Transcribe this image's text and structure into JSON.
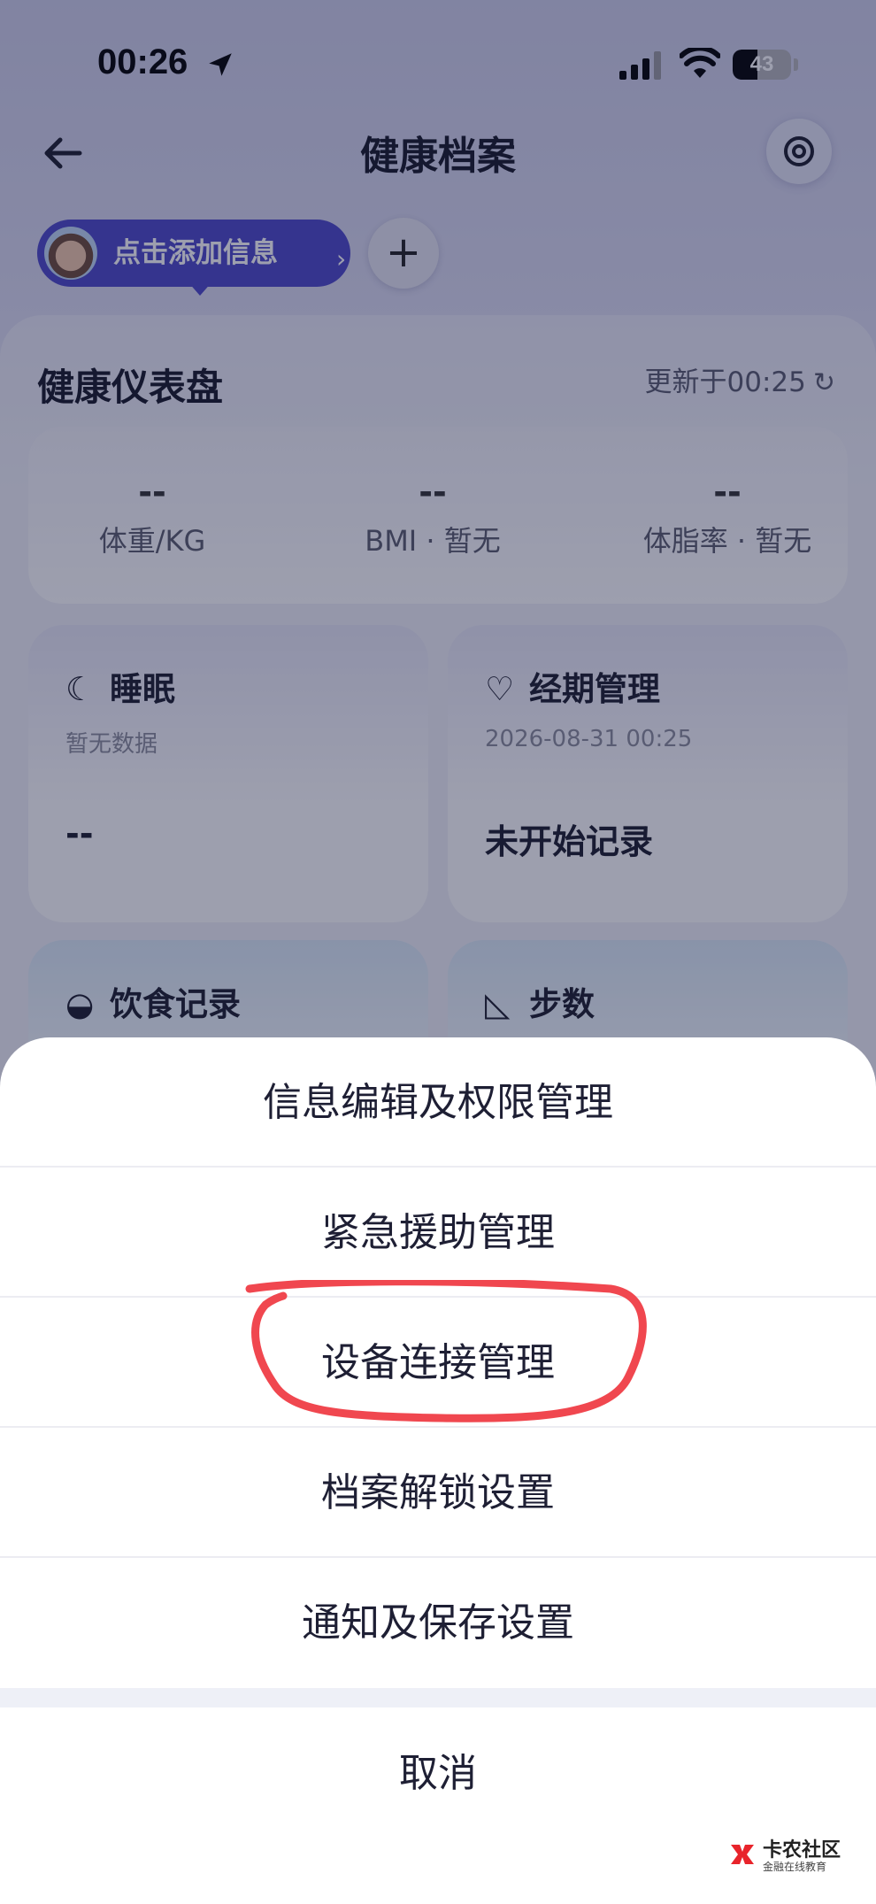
{
  "status_bar": {
    "time": "00:26",
    "battery": "43",
    "battery_level": 0.43
  },
  "header": {
    "title": "健康档案"
  },
  "profile": {
    "add_info_label": "点击添加信息",
    "chevron": "›",
    "add_symbol": "+"
  },
  "dashboard": {
    "title": "健康仪表盘",
    "updated": "更新于00:25",
    "refresh_symbol": "↻",
    "metrics": [
      {
        "value": "--",
        "label": "体重/KG"
      },
      {
        "value": "--",
        "label": "BMI · 暂无"
      },
      {
        "value": "--",
        "label": "体脂率 · 暂无"
      }
    ],
    "tiles": [
      {
        "title": "睡眠",
        "icon": "moon-icon",
        "subtitle": "暂无数据",
        "value": "--"
      },
      {
        "title": "经期管理",
        "icon": "heart-icon",
        "subtitle": "2026-08-31 00:25",
        "value": "未开始记录"
      },
      {
        "title": "饮食记录",
        "icon": "dish-icon"
      },
      {
        "title": "步数",
        "icon": "shoe-icon"
      }
    ]
  },
  "action_sheet": {
    "items": [
      {
        "label": "信息编辑及权限管理"
      },
      {
        "label": "紧急援助管理"
      },
      {
        "label": "设备连接管理",
        "highlighted": true
      },
      {
        "label": "档案解锁设置"
      },
      {
        "label": "通知及保存设置"
      }
    ],
    "cancel": "取消",
    "highlight_color": "#f0474f"
  },
  "watermark": {
    "title": "卡农社区",
    "subtitle": "金融在线教育"
  }
}
